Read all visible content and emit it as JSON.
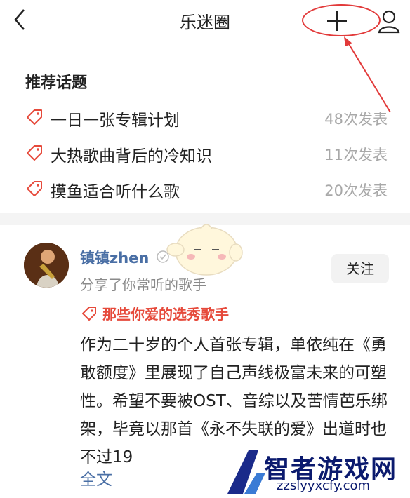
{
  "header": {
    "title": "乐迷圈",
    "back_icon": "chevron-left-icon",
    "add_icon": "plus-icon",
    "profile_icon": "user-icon"
  },
  "topics": {
    "heading": "推荐话题",
    "items": [
      {
        "label": "一日一张专辑计划",
        "count": "48次发表"
      },
      {
        "label": "大热歌曲背后的冷知识",
        "count": "11次发表"
      },
      {
        "label": "摸鱼适合听什么歌",
        "count": "20次发表"
      }
    ]
  },
  "post": {
    "username": "镇镇zhen",
    "subtitle": "分享了你常听的歌手",
    "follow_label": "关注",
    "hashtag": "那些你爱的选秀歌手",
    "body": "作为二十岁的个人首张专辑，单依纯在《勇敢额度》里展现了自己声线极富未来的可塑性。希望不要被OST、音综以及苦情芭乐绑架，毕竟以那首《永不失联的爱》出道时也不过19",
    "full_text_link": "全文"
  },
  "watermark": {
    "name": "智者游戏网",
    "site": "zzslyyxcfy.com"
  },
  "colors": {
    "annotation_red": "#e23a3a",
    "tag_red": "#e64a3b",
    "link_blue": "#4a6fa5",
    "muted_gray": "#a8a8a8"
  }
}
